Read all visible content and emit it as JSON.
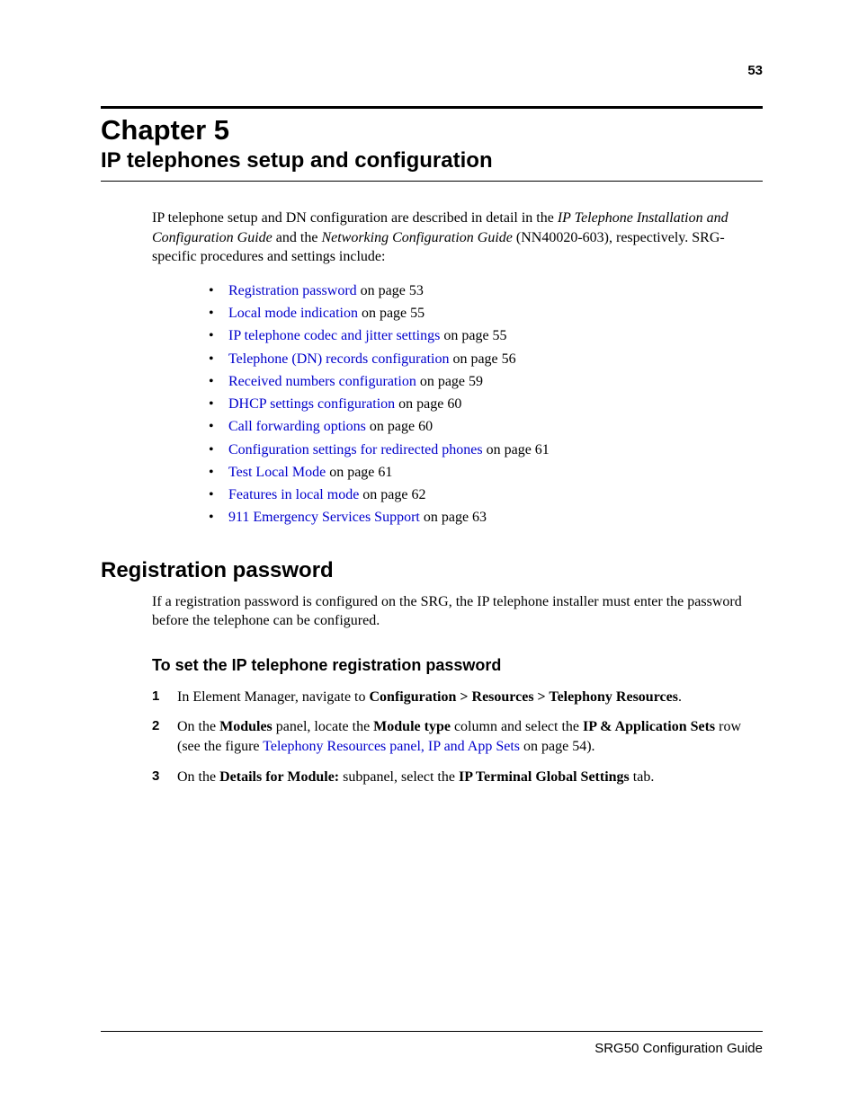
{
  "page_number_top": "53",
  "chapter": {
    "label": "Chapter 5",
    "title": "IP telephones setup and configuration"
  },
  "intro": {
    "pre": "IP telephone setup and DN configuration are described in detail in the ",
    "ital1": "IP Telephone Installation and Configuration Guide",
    "mid": " and the ",
    "ital2": "Networking Configuration Guide",
    "post": " (NN40020-603), respectively. SRG-specific procedures and settings include:"
  },
  "toc": [
    {
      "link": "Registration password",
      "suffix": " on page 53"
    },
    {
      "link": "Local mode indication",
      "suffix": " on page 55"
    },
    {
      "link": "IP telephone codec and jitter settings",
      "suffix": " on page 55"
    },
    {
      "link": "Telephone (DN) records configuration",
      "suffix": " on page 56"
    },
    {
      "link": "Received numbers configuration",
      "suffix": " on page 59"
    },
    {
      "link": "DHCP settings configuration",
      "suffix": " on page 60"
    },
    {
      "link": "Call forwarding options",
      "suffix": " on page 60"
    },
    {
      "link": "Configuration settings for redirected phones",
      "suffix": " on page 61"
    },
    {
      "link": "Test Local Mode",
      "suffix": " on page 61"
    },
    {
      "link": "Features in local mode",
      "suffix": " on page 62"
    },
    {
      "link": "911 Emergency Services Support",
      "suffix": " on page 63"
    }
  ],
  "section": {
    "heading": "Registration password",
    "para": "If a registration password is configured on the SRG, the IP telephone installer must enter the password before the telephone can be configured.",
    "subheading": "To set the IP telephone registration password"
  },
  "steps": {
    "s1": {
      "t1": "In Element Manager, navigate to ",
      "b1": "Configuration > Resources > Telephony Resources",
      "t2": "."
    },
    "s2": {
      "t1": "On the ",
      "b1": "Modules",
      "t2": " panel, locate the ",
      "b2": "Module type",
      "t3": " column and select the ",
      "b3": "IP & Application Sets",
      "t4": " row (see the figure ",
      "link": "Telephony Resources panel, IP and App Sets",
      "t5": " on page 54)."
    },
    "s3": {
      "t1": "On the ",
      "b1": "Details for Module:",
      "t2": " subpanel, select the ",
      "b2": "IP Terminal Global Settings",
      "t3": " tab."
    }
  },
  "footer": "SRG50 Configuration Guide"
}
